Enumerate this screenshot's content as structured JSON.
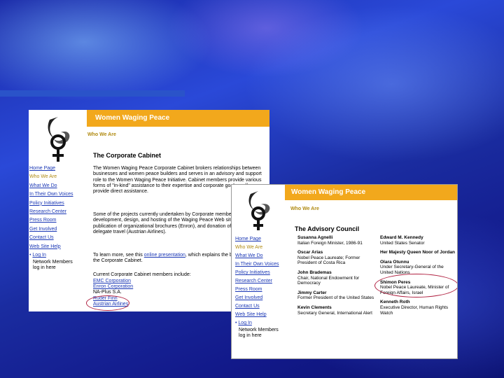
{
  "corporate_page": {
    "banner_title": "Women Waging Peace",
    "section_label": "Who We Are",
    "heading": "The Corporate Cabinet",
    "nav": [
      "Home Page",
      "Who We Are",
      "What We Do",
      "In Their Own Voices",
      "Policy Initiatives",
      "Research Center",
      "Press Room",
      "Get Involved",
      "Contact Us",
      "Web Site Help"
    ],
    "login": {
      "label": "Log In",
      "note_line1": "Network Members",
      "note_line2": "log in here"
    },
    "paragraph1": "The Women Waging Peace Corporate Cabinet brokers relationships between businesses and women peace builders and serves in an advisory and support role to the Women Waging Peace Initiative. Cabinet members provide various forms of \"in-kind\" assistance to their expertise and corporate goals and/or provide direct assistance.",
    "paragraph2": "Some of the projects currently undertaken by Corporate members include the development, design, and hosting of the Waging Peace Web site (EMC), publication of organizational brochures (Enron), and donation of airfare for delegate travel (Austrian Airlines).",
    "paragraph3_before": "To learn more, see this ",
    "paragraph3_link": "online presentation",
    "paragraph3_after": ", which explains the benefits of joining the Corporate Cabinet.",
    "members_intro": "Current Corporate Cabinet members include:",
    "members": [
      "EMC Corporation",
      "Enron Corporation",
      "NA-Plus S.A.",
      "Ruder Finn",
      "Austrian Airlines"
    ]
  },
  "council_page": {
    "banner_title": "Women Waging Peace",
    "section_label": "Who We Are",
    "heading": "The Advisory Council",
    "nav": [
      "Home Page",
      "Who We Are",
      "What We Do",
      "In Their Own Voices",
      "Policy Initiatives",
      "Research Center",
      "Press Room",
      "Get Involved",
      "Contact Us",
      "Web Site Help"
    ],
    "login": {
      "label": "Log In",
      "note_line1": "Network Members",
      "note_line2": "log in here"
    },
    "left_column": [
      {
        "name": "Susanna Agnelli",
        "desc": "Italian Foreign Minister, 1986-91"
      },
      {
        "name": "Oscar Arias",
        "desc": "Nobel Peace Laureate; Former President of Costa Rica"
      },
      {
        "name": "John Brademas",
        "desc": "Chair, National Endowment for Democracy"
      },
      {
        "name": "Jimmy Carter",
        "desc": "Former President of the United States"
      },
      {
        "name": "Kevin Clements",
        "desc": "Secretary General, International Alert"
      }
    ],
    "right_column": [
      {
        "name": "Edward M. Kennedy",
        "desc": "United States Senator"
      },
      {
        "name": "Her Majesty Queen Noor of Jordan",
        "desc": ""
      },
      {
        "name": "Olara Otunnu",
        "desc": "Under Secretary-General of the United Nations"
      },
      {
        "name": "Shimon Peres",
        "desc": "Nobel Peace Laureate, Minister of Foreign Affairs, Israel"
      },
      {
        "name": "Kenneth Roth",
        "desc": "Executive Director, Human Rights Watch"
      }
    ]
  },
  "colors": {
    "banner": "#f2a81c",
    "link": "#1a37b5",
    "accent_bar": "#2a53c9",
    "highlight_circle": "#b02040"
  }
}
